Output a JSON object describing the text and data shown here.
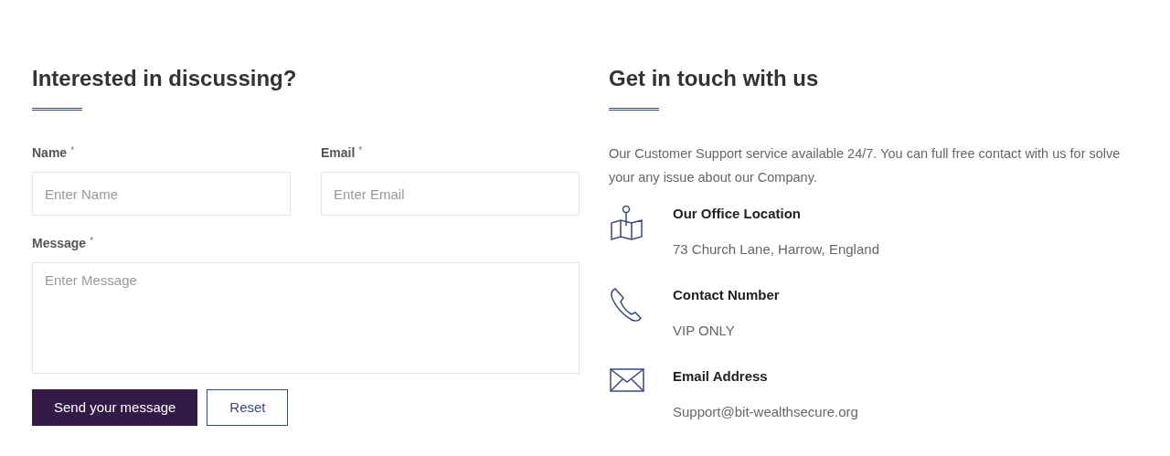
{
  "form": {
    "title": "Interested in discussing?",
    "fields": [
      {
        "kind": "input",
        "label": "Name",
        "mark": "*",
        "placeholder": "Enter Name"
      },
      {
        "kind": "input",
        "label": "Email",
        "mark": "*",
        "placeholder": "Enter Email"
      },
      {
        "kind": "textarea",
        "label": "Message",
        "mark": "*",
        "placeholder": "Enter Message"
      }
    ],
    "buttons": [
      {
        "kind": "primary",
        "label": "Send your message"
      },
      {
        "kind": "outline",
        "label": "Reset"
      }
    ]
  },
  "contact": {
    "title": "Get in touch with us",
    "intro": "Our Customer Support service available 24/7. You can full free contact with us for solve your any issue about our Company.",
    "items": [
      {
        "kind": "location",
        "title": "Our Office Location",
        "value": "73 Church Lane, Harrow, England"
      },
      {
        "kind": "phone",
        "title": "Contact Number",
        "value": "VIP ONLY"
      },
      {
        "kind": "email",
        "title": "Email Address",
        "value": "Support@bit-wealthsecure.org"
      }
    ]
  }
}
